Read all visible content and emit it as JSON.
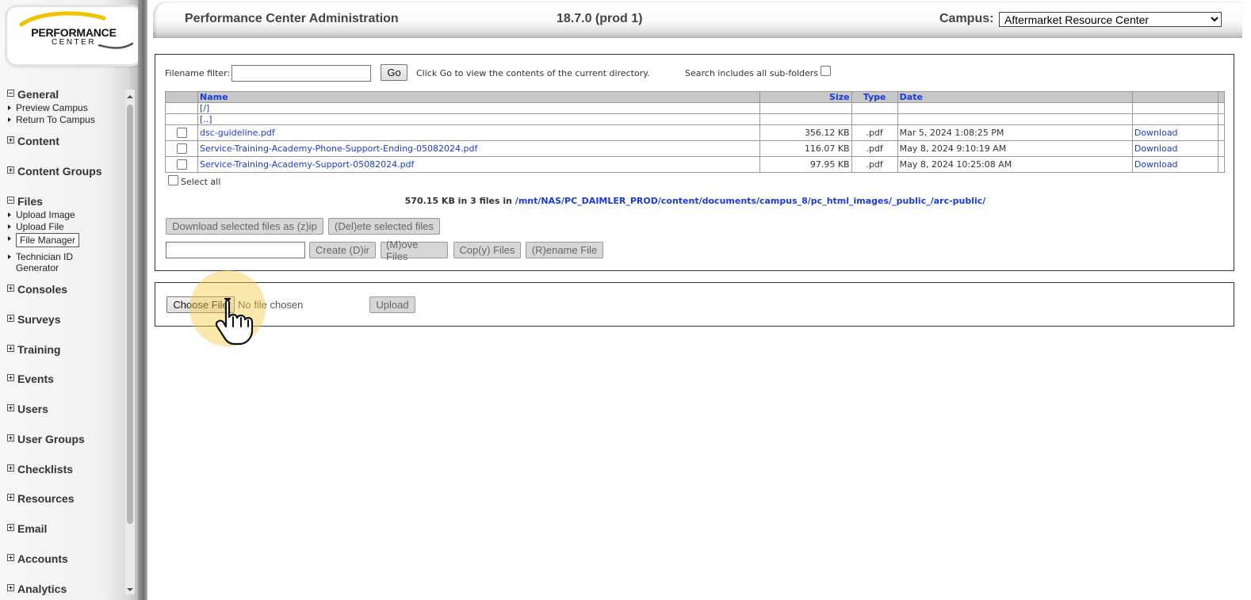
{
  "logo": {
    "line1": "PERFORMANCE",
    "line2": "CENTER",
    "accent_color": "#f2c200"
  },
  "header": {
    "title": "Performance Center Administration",
    "version": "18.7.0 (prod 1)",
    "campus_label": "Campus:",
    "campus_selected": "Aftermarket Resource Center"
  },
  "nav": {
    "groups": [
      {
        "label": "General",
        "expanded": true,
        "items": [
          "Preview Campus",
          "Return To Campus"
        ]
      },
      {
        "label": "Content",
        "expanded": false
      },
      {
        "label": "Content Groups",
        "expanded": false
      },
      {
        "label": "Files",
        "expanded": true,
        "items": [
          "Upload Image",
          "Upload File",
          "File Manager",
          "Technician ID Generator"
        ],
        "technician_line1": "Technician ID",
        "technician_line2": "Generator"
      },
      {
        "label": "Consoles",
        "expanded": false
      },
      {
        "label": "Surveys",
        "expanded": false
      },
      {
        "label": "Training",
        "expanded": false
      },
      {
        "label": "Events",
        "expanded": false
      },
      {
        "label": "Users",
        "expanded": false
      },
      {
        "label": "User Groups",
        "expanded": false
      },
      {
        "label": "Checklists",
        "expanded": false
      },
      {
        "label": "Resources",
        "expanded": false
      },
      {
        "label": "Email",
        "expanded": false
      },
      {
        "label": "Accounts",
        "expanded": false
      },
      {
        "label": "Analytics",
        "expanded": false
      }
    ]
  },
  "file_manager": {
    "filter_label": "Filename filter:",
    "filter_value": "",
    "go_label": "Go",
    "hint": "Click Go to view the contents of the current directory.",
    "subfolders_label": "Search includes all sub-folders",
    "columns": {
      "name": "Name",
      "size": "Size",
      "type": "Type",
      "date": "Date"
    },
    "dir_links": [
      "[/]",
      "[..]"
    ],
    "files": [
      {
        "name": "dsc-guideline.pdf",
        "size": "356.12 KB",
        "type": ".pdf",
        "date": "Mar 5, 2024 1:08:25 PM",
        "action": "Download"
      },
      {
        "name": "Service-Training-Academy-Phone-Support-Ending-05082024.pdf",
        "size": "116.07 KB",
        "type": ".pdf",
        "date": "May 8, 2024 9:10:19 AM",
        "action": "Download"
      },
      {
        "name": "Service-Training-Academy-Support-05082024.pdf",
        "size": "97.95 KB",
        "type": ".pdf",
        "date": "May 8, 2024 10:25:08 AM",
        "action": "Download"
      }
    ],
    "select_all_label": "Select all",
    "summary_prefix": "570.15 KB in 3 files in",
    "summary_path": "/mnt/NAS/PC_DAIMLER_PROD/content/documents/campus_8/pc_html_images/_public_/arc-public/",
    "buttons": {
      "zip": "Download selected files as (z)ip",
      "delete": "(Del)ete selected files",
      "create_dir": "Create (D)ir",
      "move": "(M)ove Files",
      "copy": "Cop(y) Files",
      "rename": "(R)ename File"
    },
    "dir_name_value": ""
  },
  "upload": {
    "choose_label": "Choose File",
    "no_file_label": "No file chosen",
    "upload_label": "Upload"
  }
}
